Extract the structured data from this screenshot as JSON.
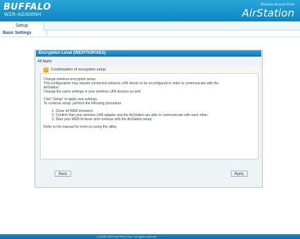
{
  "header": {
    "brand": "BUFFALO",
    "model": "WZR-AG300NH",
    "tagline": "Wireless Access Point",
    "product": "AirStation"
  },
  "nav": {
    "tab_setup": "Setup",
    "subnav_basic": "Basic Settings",
    "subnav_sep": "|"
  },
  "dialog": {
    "title": "Encryption Level (WEP/TKIP/AES)",
    "subtitle": "All Apply",
    "confirm_title": "Confirmation of encryption setup",
    "lines": [
      "Change wireless encryption setup.",
      "This configuration may require connected wireless LAN clients to be reconfigured in order to communicate with the",
      "AirStation.",
      "Change the same settings in your wireless LAN devices as well.",
      "",
      "Click \"Setup\" to apply new settings.",
      "To continue setup, perform the following procedure."
    ],
    "steps": [
      "1.  Close all WEB browsers.",
      "2.  Confirm that your wireless LAN adapter and the AirStation are able to communicate with each other.",
      "3.  Start your WEB browser and continue with the AirStation setup."
    ],
    "refer": "Refer to the manual for more on using the utility.",
    "back_label": "Back",
    "apply_label": "Apply"
  },
  "footer": {
    "text": "(C)2000-2009 BUFFALO INC. All rights reserved."
  },
  "colors": {
    "accent": "#1185c6",
    "arrow": "#f0a51a"
  }
}
